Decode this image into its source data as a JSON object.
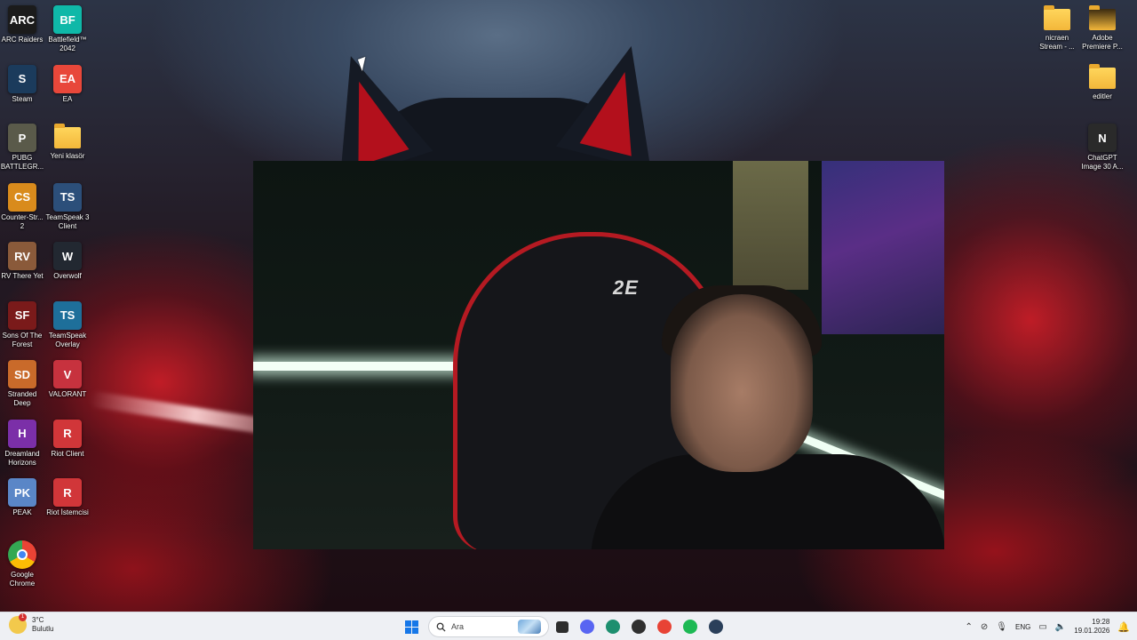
{
  "desktop": {
    "left_icons": [
      {
        "label": "ARC Raiders",
        "glyph": "ARC",
        "color": "#1b1b1b"
      },
      {
        "label": "Battlefield™ 2042",
        "glyph": "BF",
        "color": "#0fb8a8"
      },
      {
        "label": "Steam",
        "glyph": "S",
        "color": "#1b3b5c"
      },
      {
        "label": "EA",
        "glyph": "EA",
        "color": "#e8473a"
      },
      {
        "label": "PUBG BATTLEGR...",
        "glyph": "P",
        "color": "#5a5a4a"
      },
      {
        "label": "Yeni klasör",
        "glyph": "",
        "color": "folder"
      },
      {
        "label": "Counter-Str... 2",
        "glyph": "CS",
        "color": "#d98b1c"
      },
      {
        "label": "TeamSpeak 3 Client",
        "glyph": "TS",
        "color": "#2c4f7a"
      },
      {
        "label": "RV There Yet",
        "glyph": "RV",
        "color": "#8a5a3a"
      },
      {
        "label": "Overwolf",
        "glyph": "W",
        "color": "#222831"
      },
      {
        "label": "Sons Of The Forest",
        "glyph": "SF",
        "color": "#7a1a1a"
      },
      {
        "label": "TeamSpeak Overlay",
        "glyph": "TS",
        "color": "#1e6f9a"
      },
      {
        "label": "Stranded Deep",
        "glyph": "SD",
        "color": "#c96a2a"
      },
      {
        "label": "VALORANT",
        "glyph": "V",
        "color": "#c7323e"
      },
      {
        "label": "Dreamland Horizons",
        "glyph": "H",
        "color": "#7b2fa8"
      },
      {
        "label": "Riot Client",
        "glyph": "R",
        "color": "#d13639"
      },
      {
        "label": "PEAK",
        "glyph": "PK",
        "color": "#5a86c7"
      },
      {
        "label": "Riot İstemcisi",
        "glyph": "R",
        "color": "#d13639"
      },
      {
        "label": "Google Chrome",
        "glyph": "G",
        "color": "chrome"
      }
    ],
    "right_icons": [
      {
        "label": "nicraen Stream - ...",
        "glyph": "",
        "color": "folder"
      },
      {
        "label": "Adobe Premiere P...",
        "glyph": "",
        "color": "folder-dark"
      },
      {
        "label": "editler",
        "glyph": "",
        "color": "folder"
      },
      {
        "label": "ChatGPT Image 30 A...",
        "glyph": "N",
        "color": "#2a2a2a"
      }
    ]
  },
  "webcam": {
    "chair_brand": "2E"
  },
  "taskbar": {
    "weather_temp": "3°C",
    "weather_desc": "Bulutlu",
    "weather_badge": "1",
    "search_placeholder": "Ara",
    "apps": [
      {
        "name": "task-view",
        "color": "#2d2d2d"
      },
      {
        "name": "discord",
        "color": "#5865f2"
      },
      {
        "name": "terminal",
        "color": "#1d8f6f"
      },
      {
        "name": "app-dark",
        "color": "#303030"
      },
      {
        "name": "chrome",
        "color": "#e84335"
      },
      {
        "name": "spotify",
        "color": "#1db954"
      },
      {
        "name": "steam",
        "color": "#2a3f5a"
      }
    ],
    "language": "ENG",
    "time": "19:28",
    "date": "19.01.2026"
  }
}
